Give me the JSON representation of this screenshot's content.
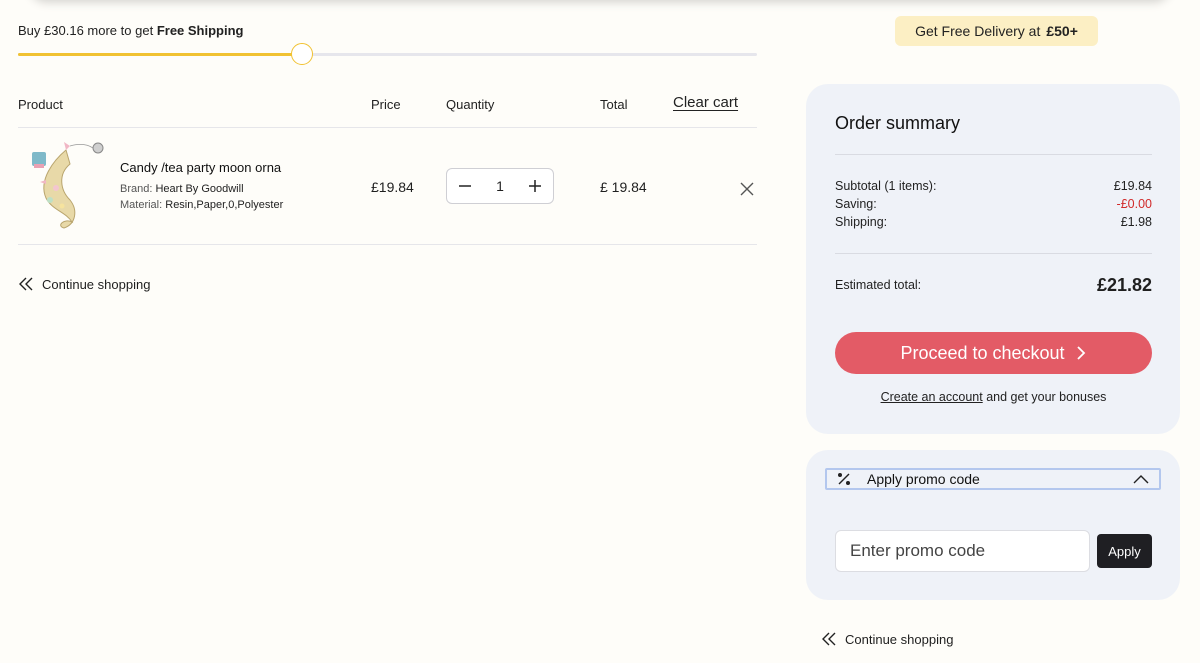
{
  "shipping": {
    "prefix": "Buy",
    "amount": "£30.16",
    "middle": "more to get",
    "bold": "Free Shipping",
    "progress_fraction": 0.384
  },
  "badge": {
    "text": "Get Free Delivery at",
    "amount": "£50+"
  },
  "table": {
    "headers": {
      "product": "Product",
      "price": "Price",
      "quantity": "Quantity",
      "total": "Total"
    },
    "clear_cart": "Clear cart"
  },
  "item": {
    "name": "Candy /tea party moon orna",
    "brand_label": "Brand:",
    "brand": "Heart By Goodwill",
    "material_label": "Material:",
    "material": "Resin,Paper,0,Polyester",
    "price": "£19.84",
    "quantity": "1",
    "total": "£ 19.84"
  },
  "continue_label": "Continue shopping",
  "summary": {
    "title": "Order summary",
    "rows": [
      {
        "label": "Subtotal (1 items):",
        "value": "£19.84"
      },
      {
        "label": "Saving:",
        "value": "-£0.00"
      },
      {
        "label": "Shipping:",
        "value": "£1.98"
      }
    ],
    "estimated_label": "Estimated total:",
    "estimated_value": "£21.82",
    "checkout_label": "Proceed to checkout",
    "account_link": "Create an account",
    "account_suffix": "and get your bonuses"
  },
  "promo": {
    "title": "Apply promo code",
    "placeholder": "Enter promo code",
    "apply_label": "Apply"
  },
  "colors": {
    "background": "#fefdf9",
    "progress": "#f1c232",
    "badge": "#fcefc4",
    "checkout": "#e35b66",
    "negative": "#d12a2a",
    "card": "#eff2f8"
  }
}
